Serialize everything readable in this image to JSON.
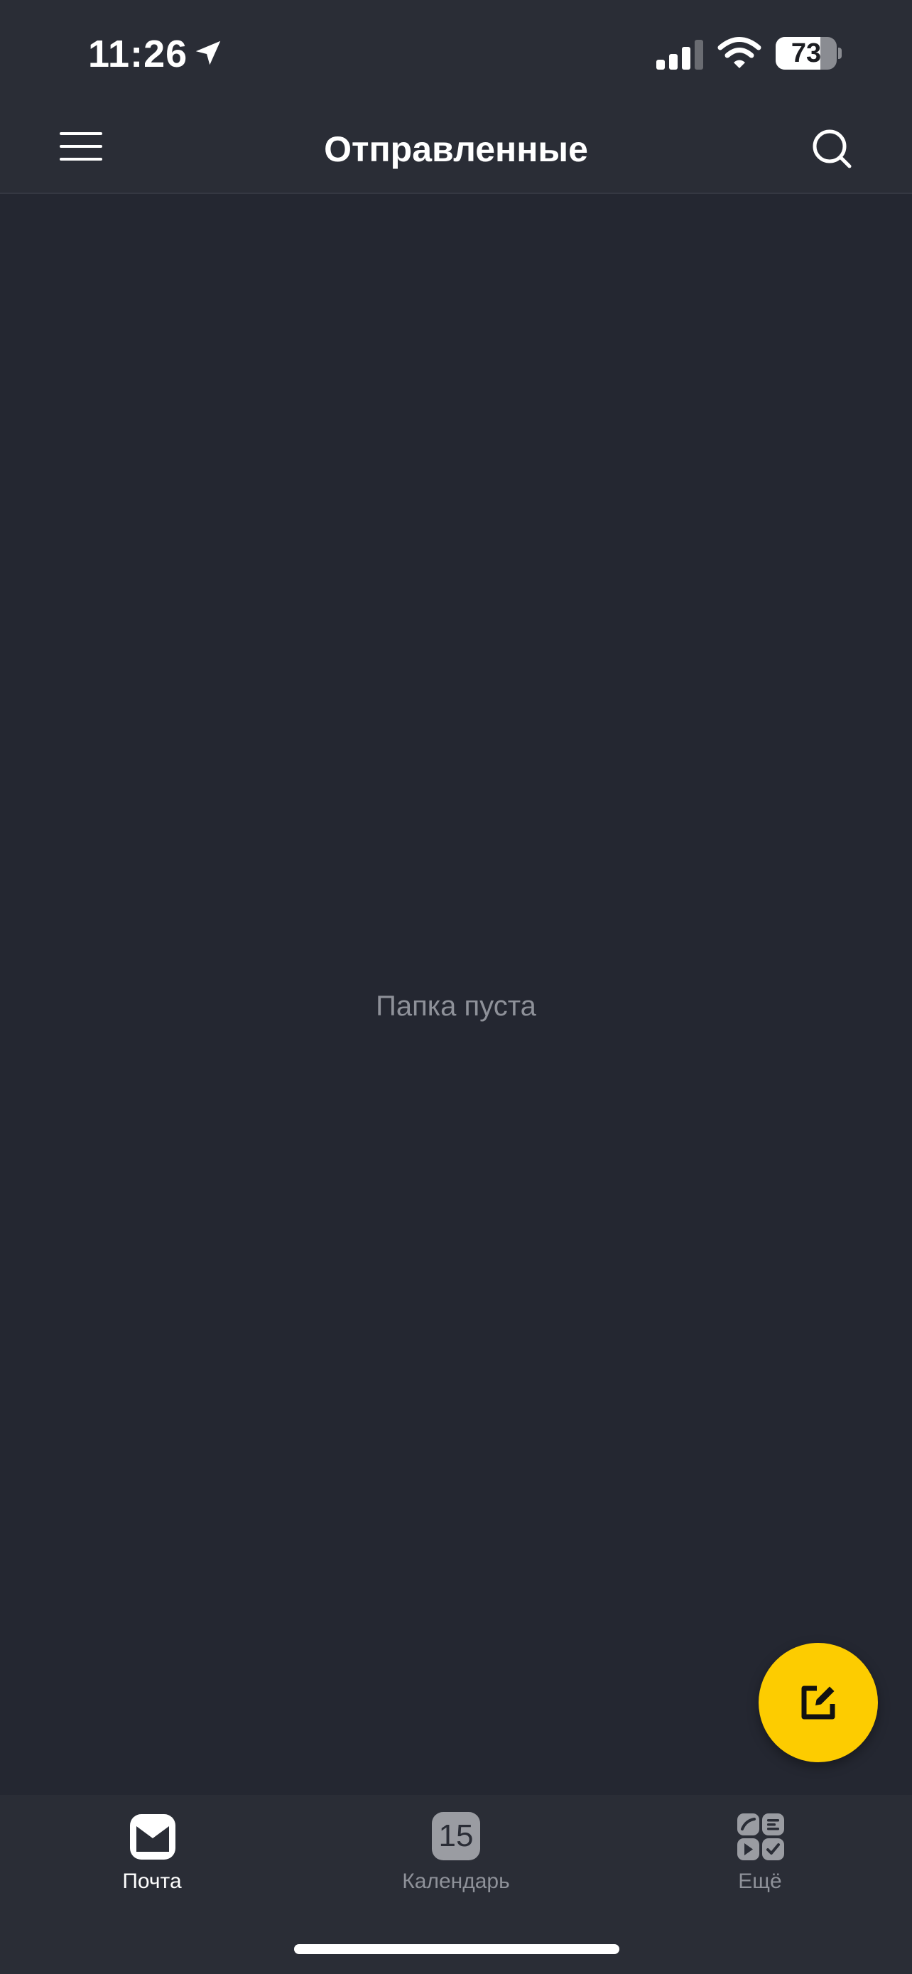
{
  "status_bar": {
    "time": "11:26",
    "battery_level": "73",
    "battery_fraction": 0.73,
    "icons": [
      "location-arrow-icon",
      "cellular-signal-icon",
      "wifi-icon",
      "battery-icon"
    ]
  },
  "header": {
    "title": "Отправленные",
    "menu_icon": "hamburger-menu-icon",
    "search_icon": "search-icon"
  },
  "content": {
    "empty_message": "Папка пуста"
  },
  "compose": {
    "icon": "compose-icon",
    "color": "#fdcc00"
  },
  "tabs": [
    {
      "label": "Почта",
      "icon": "mail-icon",
      "active": true
    },
    {
      "label": "Календарь",
      "icon": "calendar-icon",
      "day": "15",
      "active": false
    },
    {
      "label": "Ещё",
      "icon": "more-apps-icon",
      "active": false
    }
  ],
  "colors": {
    "background": "#242731",
    "bars": "#2a2d36",
    "accent": "#fdcc00",
    "muted_text": "#8e9199"
  }
}
